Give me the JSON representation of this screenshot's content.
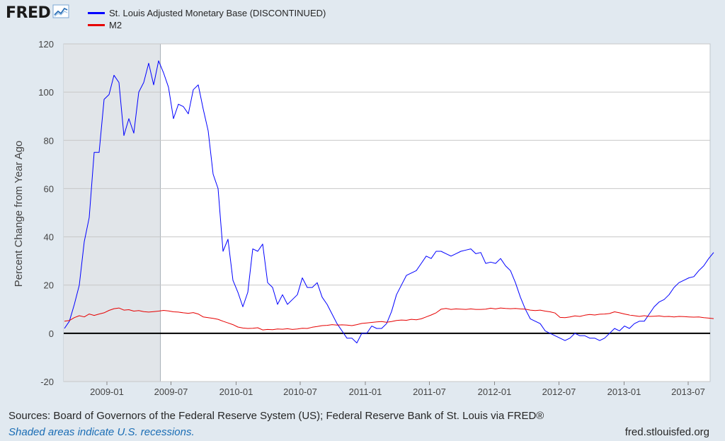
{
  "header": {
    "logo_text": "FRED",
    "logo_icon": "trend-line-icon"
  },
  "chart_data": {
    "type": "line",
    "title": "",
    "xlabel": "",
    "ylabel": "Percent Change from Year Ago",
    "ylim": [
      -20,
      120
    ],
    "yticks": [
      -20,
      0,
      20,
      40,
      60,
      80,
      100,
      120
    ],
    "xlim": [
      "2008-09",
      "2013-09"
    ],
    "xticks": [
      "2009-01",
      "2009-07",
      "2010-01",
      "2010-07",
      "2011-01",
      "2011-07",
      "2012-01",
      "2012-07",
      "2013-01",
      "2013-07"
    ],
    "grid": true,
    "legend_position": "top-left",
    "recessions": [
      {
        "start": "2008-09",
        "end": "2009-06"
      }
    ],
    "series": [
      {
        "name": "St. Louis Adjusted Monetary Base (DISCONTINUED)",
        "color": "#0000ff",
        "points": [
          [
            "2008-09-03",
            2
          ],
          [
            "2008-09-17",
            5
          ],
          [
            "2008-10-01",
            12
          ],
          [
            "2008-10-15",
            20
          ],
          [
            "2008-10-29",
            38
          ],
          [
            "2008-11-12",
            48
          ],
          [
            "2008-11-26",
            75
          ],
          [
            "2008-12-10",
            75
          ],
          [
            "2008-12-24",
            97
          ],
          [
            "2009-01-07",
            99
          ],
          [
            "2009-01-21",
            107
          ],
          [
            "2009-02-04",
            104
          ],
          [
            "2009-02-18",
            82
          ],
          [
            "2009-03-04",
            89
          ],
          [
            "2009-03-18",
            83
          ],
          [
            "2009-04-01",
            100
          ],
          [
            "2009-04-15",
            104
          ],
          [
            "2009-04-29",
            112
          ],
          [
            "2009-05-13",
            103
          ],
          [
            "2009-05-27",
            113
          ],
          [
            "2009-06-10",
            108
          ],
          [
            "2009-06-24",
            102
          ],
          [
            "2009-07-08",
            89
          ],
          [
            "2009-07-22",
            95
          ],
          [
            "2009-08-05",
            94
          ],
          [
            "2009-08-19",
            91
          ],
          [
            "2009-09-02",
            101
          ],
          [
            "2009-09-16",
            103
          ],
          [
            "2009-09-30",
            93
          ],
          [
            "2009-10-14",
            84
          ],
          [
            "2009-10-28",
            66
          ],
          [
            "2009-11-11",
            60
          ],
          [
            "2009-11-25",
            34
          ],
          [
            "2009-12-09",
            39
          ],
          [
            "2009-12-23",
            22
          ],
          [
            "2010-01-06",
            17
          ],
          [
            "2010-01-20",
            11
          ],
          [
            "2010-02-03",
            17
          ],
          [
            "2010-02-17",
            35
          ],
          [
            "2010-03-03",
            34
          ],
          [
            "2010-03-17",
            37
          ],
          [
            "2010-03-31",
            21
          ],
          [
            "2010-04-14",
            19
          ],
          [
            "2010-04-28",
            12
          ],
          [
            "2010-05-12",
            16
          ],
          [
            "2010-05-26",
            12
          ],
          [
            "2010-06-09",
            14
          ],
          [
            "2010-06-23",
            16
          ],
          [
            "2010-07-07",
            23
          ],
          [
            "2010-07-21",
            19
          ],
          [
            "2010-08-04",
            19
          ],
          [
            "2010-08-18",
            21
          ],
          [
            "2010-09-01",
            15
          ],
          [
            "2010-09-15",
            12
          ],
          [
            "2010-09-29",
            8
          ],
          [
            "2010-10-13",
            4
          ],
          [
            "2010-10-27",
            1
          ],
          [
            "2010-11-10",
            -2
          ],
          [
            "2010-11-24",
            -2
          ],
          [
            "2010-12-08",
            -4
          ],
          [
            "2010-12-22",
            0
          ],
          [
            "2011-01-05",
            0
          ],
          [
            "2011-01-19",
            3
          ],
          [
            "2011-02-02",
            2
          ],
          [
            "2011-02-16",
            2
          ],
          [
            "2011-03-02",
            4
          ],
          [
            "2011-03-16",
            9
          ],
          [
            "2011-03-30",
            16
          ],
          [
            "2011-04-13",
            20
          ],
          [
            "2011-04-27",
            24
          ],
          [
            "2011-05-11",
            25
          ],
          [
            "2011-05-25",
            26
          ],
          [
            "2011-06-08",
            29
          ],
          [
            "2011-06-22",
            32
          ],
          [
            "2011-07-06",
            31
          ],
          [
            "2011-07-20",
            34
          ],
          [
            "2011-08-03",
            34
          ],
          [
            "2011-08-17",
            33
          ],
          [
            "2011-08-31",
            32
          ],
          [
            "2011-09-14",
            33
          ],
          [
            "2011-09-28",
            34
          ],
          [
            "2011-10-12",
            34.5
          ],
          [
            "2011-10-26",
            35
          ],
          [
            "2011-11-09",
            33
          ],
          [
            "2011-11-23",
            33.5
          ],
          [
            "2011-12-07",
            29
          ],
          [
            "2011-12-21",
            29.5
          ],
          [
            "2012-01-04",
            29
          ],
          [
            "2012-01-18",
            31
          ],
          [
            "2012-02-01",
            28
          ],
          [
            "2012-02-15",
            26
          ],
          [
            "2012-02-29",
            21
          ],
          [
            "2012-03-14",
            15
          ],
          [
            "2012-03-28",
            10
          ],
          [
            "2012-04-11",
            6
          ],
          [
            "2012-04-25",
            5
          ],
          [
            "2012-05-09",
            4
          ],
          [
            "2012-05-23",
            1
          ],
          [
            "2012-06-06",
            0
          ],
          [
            "2012-06-20",
            -1
          ],
          [
            "2012-07-04",
            -2
          ],
          [
            "2012-07-18",
            -3
          ],
          [
            "2012-08-01",
            -2
          ],
          [
            "2012-08-15",
            0
          ],
          [
            "2012-08-29",
            -1
          ],
          [
            "2012-09-12",
            -1
          ],
          [
            "2012-09-26",
            -2
          ],
          [
            "2012-10-10",
            -2
          ],
          [
            "2012-10-24",
            -3
          ],
          [
            "2012-11-07",
            -2
          ],
          [
            "2012-11-21",
            0
          ],
          [
            "2012-12-05",
            2
          ],
          [
            "2012-12-19",
            1
          ],
          [
            "2013-01-02",
            3
          ],
          [
            "2013-01-16",
            2
          ],
          [
            "2013-01-30",
            4
          ],
          [
            "2013-02-13",
            5
          ],
          [
            "2013-02-27",
            5
          ],
          [
            "2013-03-13",
            8
          ],
          [
            "2013-03-27",
            11
          ],
          [
            "2013-04-10",
            13
          ],
          [
            "2013-04-24",
            14
          ],
          [
            "2013-05-08",
            16
          ],
          [
            "2013-05-22",
            19
          ],
          [
            "2013-06-05",
            21
          ],
          [
            "2013-06-19",
            22
          ],
          [
            "2013-07-03",
            23
          ],
          [
            "2013-07-17",
            23.5
          ],
          [
            "2013-07-31",
            26
          ],
          [
            "2013-08-14",
            28
          ],
          [
            "2013-08-28",
            31
          ],
          [
            "2013-09-11",
            33.5
          ]
        ]
      },
      {
        "name": "M2",
        "color": "#e60000",
        "points": [
          [
            "2008-09-03",
            5.0
          ],
          [
            "2008-09-17",
            5.3
          ],
          [
            "2008-10-01",
            6.5
          ],
          [
            "2008-10-15",
            7.3
          ],
          [
            "2008-10-29",
            6.8
          ],
          [
            "2008-11-12",
            8.0
          ],
          [
            "2008-11-26",
            7.4
          ],
          [
            "2008-12-10",
            8.0
          ],
          [
            "2008-12-24",
            8.5
          ],
          [
            "2009-01-07",
            9.5
          ],
          [
            "2009-01-21",
            10.2
          ],
          [
            "2009-02-04",
            10.5
          ],
          [
            "2009-02-18",
            9.6
          ],
          [
            "2009-03-04",
            9.8
          ],
          [
            "2009-03-18",
            9.2
          ],
          [
            "2009-04-01",
            9.4
          ],
          [
            "2009-04-15",
            9.0
          ],
          [
            "2009-04-29",
            8.8
          ],
          [
            "2009-05-13",
            9.0
          ],
          [
            "2009-05-27",
            9.2
          ],
          [
            "2009-06-10",
            9.5
          ],
          [
            "2009-06-24",
            9.3
          ],
          [
            "2009-07-08",
            8.9
          ],
          [
            "2009-07-22",
            8.8
          ],
          [
            "2009-08-05",
            8.5
          ],
          [
            "2009-08-19",
            8.3
          ],
          [
            "2009-09-02",
            8.6
          ],
          [
            "2009-09-16",
            8.0
          ],
          [
            "2009-09-30",
            6.8
          ],
          [
            "2009-10-14",
            6.5
          ],
          [
            "2009-10-28",
            6.2
          ],
          [
            "2009-11-11",
            5.8
          ],
          [
            "2009-11-25",
            5.0
          ],
          [
            "2009-12-09",
            4.3
          ],
          [
            "2009-12-23",
            3.6
          ],
          [
            "2010-01-06",
            2.6
          ],
          [
            "2010-01-20",
            2.2
          ],
          [
            "2010-02-03",
            2.0
          ],
          [
            "2010-02-17",
            2.1
          ],
          [
            "2010-03-03",
            2.3
          ],
          [
            "2010-03-17",
            1.4
          ],
          [
            "2010-03-31",
            1.6
          ],
          [
            "2010-04-14",
            1.5
          ],
          [
            "2010-04-28",
            1.8
          ],
          [
            "2010-05-12",
            1.7
          ],
          [
            "2010-05-26",
            1.9
          ],
          [
            "2010-06-09",
            1.6
          ],
          [
            "2010-06-23",
            1.8
          ],
          [
            "2010-07-07",
            2.1
          ],
          [
            "2010-07-21",
            2.0
          ],
          [
            "2010-08-04",
            2.5
          ],
          [
            "2010-08-18",
            2.8
          ],
          [
            "2010-09-01",
            3.2
          ],
          [
            "2010-09-15",
            3.3
          ],
          [
            "2010-09-29",
            3.6
          ],
          [
            "2010-10-13",
            3.4
          ],
          [
            "2010-10-27",
            3.5
          ],
          [
            "2010-11-10",
            3.4
          ],
          [
            "2010-11-24",
            3.2
          ],
          [
            "2010-12-08",
            3.6
          ],
          [
            "2010-12-22",
            4.1
          ],
          [
            "2011-01-05",
            4.3
          ],
          [
            "2011-01-19",
            4.5
          ],
          [
            "2011-02-02",
            4.7
          ],
          [
            "2011-02-16",
            4.9
          ],
          [
            "2011-03-02",
            4.6
          ],
          [
            "2011-03-16",
            4.9
          ],
          [
            "2011-03-30",
            5.3
          ],
          [
            "2011-04-13",
            5.5
          ],
          [
            "2011-04-27",
            5.4
          ],
          [
            "2011-05-11",
            5.8
          ],
          [
            "2011-05-25",
            5.6
          ],
          [
            "2011-06-08",
            6.0
          ],
          [
            "2011-06-22",
            6.8
          ],
          [
            "2011-07-06",
            7.6
          ],
          [
            "2011-07-20",
            8.5
          ],
          [
            "2011-08-03",
            10.0
          ],
          [
            "2011-08-17",
            10.3
          ],
          [
            "2011-08-31",
            9.9
          ],
          [
            "2011-09-14",
            10.1
          ],
          [
            "2011-09-28",
            10.0
          ],
          [
            "2011-10-12",
            9.9
          ],
          [
            "2011-10-26",
            10.1
          ],
          [
            "2011-11-09",
            9.9
          ],
          [
            "2011-11-23",
            9.9
          ],
          [
            "2011-12-07",
            10.0
          ],
          [
            "2011-12-21",
            10.4
          ],
          [
            "2012-01-04",
            10.1
          ],
          [
            "2012-01-18",
            10.5
          ],
          [
            "2012-02-01",
            10.3
          ],
          [
            "2012-02-15",
            10.2
          ],
          [
            "2012-02-29",
            10.3
          ],
          [
            "2012-03-14",
            10.1
          ],
          [
            "2012-03-28",
            10.0
          ],
          [
            "2012-04-11",
            9.6
          ],
          [
            "2012-04-25",
            9.4
          ],
          [
            "2012-05-09",
            9.6
          ],
          [
            "2012-05-23",
            9.2
          ],
          [
            "2012-06-06",
            8.9
          ],
          [
            "2012-06-20",
            8.4
          ],
          [
            "2012-07-04",
            6.6
          ],
          [
            "2012-07-18",
            6.5
          ],
          [
            "2012-08-01",
            6.8
          ],
          [
            "2012-08-15",
            7.2
          ],
          [
            "2012-08-29",
            7.0
          ],
          [
            "2012-09-12",
            7.5
          ],
          [
            "2012-09-26",
            7.8
          ],
          [
            "2012-10-10",
            7.6
          ],
          [
            "2012-10-24",
            7.9
          ],
          [
            "2012-11-07",
            8.0
          ],
          [
            "2012-11-21",
            8.2
          ],
          [
            "2012-12-05",
            8.9
          ],
          [
            "2012-12-19",
            8.5
          ],
          [
            "2013-01-02",
            8.0
          ],
          [
            "2013-01-16",
            7.6
          ],
          [
            "2013-01-30",
            7.3
          ],
          [
            "2013-02-13",
            7.0
          ],
          [
            "2013-02-27",
            7.3
          ],
          [
            "2013-03-13",
            7.0
          ],
          [
            "2013-03-27",
            7.1
          ],
          [
            "2013-04-10",
            7.2
          ],
          [
            "2013-04-24",
            6.9
          ],
          [
            "2013-05-08",
            7.0
          ],
          [
            "2013-05-22",
            6.8
          ],
          [
            "2013-06-05",
            7.0
          ],
          [
            "2013-06-19",
            6.9
          ],
          [
            "2013-07-03",
            6.8
          ],
          [
            "2013-07-17",
            6.7
          ],
          [
            "2013-07-31",
            6.8
          ],
          [
            "2013-08-14",
            6.5
          ],
          [
            "2013-08-28",
            6.3
          ],
          [
            "2013-09-11",
            6.1
          ]
        ]
      }
    ]
  },
  "footer": {
    "sources": "Sources: Board of Governors of the Federal Reserve System (US); Federal Reserve Bank of St. Louis via FRED®",
    "shaded_note": "Shaded areas indicate U.S. recessions.",
    "url": "fred.stlouisfed.org"
  }
}
